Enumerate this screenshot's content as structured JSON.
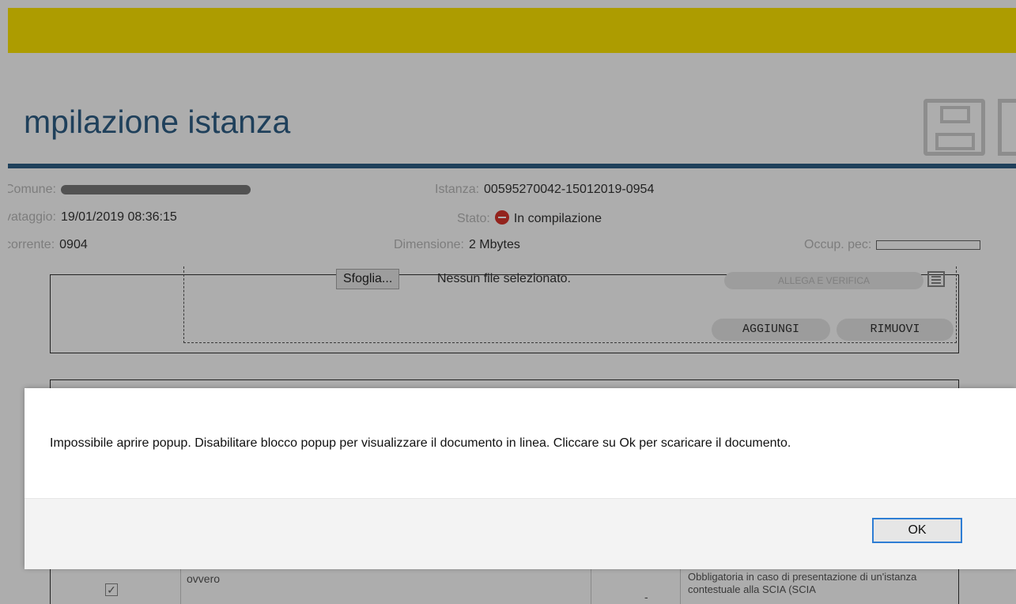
{
  "header": {
    "title": "mpilazione istanza"
  },
  "info": {
    "comune_label": "Comune:",
    "salvataggio_label": "vataggio:",
    "salvataggio_value": "19/01/2019 08:36:15",
    "corrente_label": "corrente:",
    "corrente_value": "0904",
    "istanza_label": "Istanza:",
    "istanza_value": "00595270042-15012019-0954",
    "stato_label": "Stato:",
    "stato_value": "In compilazione",
    "dimensione_label": "Dimensione:",
    "dimensione_value": "2 Mbytes",
    "occup_label": "Occup. pec:"
  },
  "upload": {
    "browse_label": "Sfoglia...",
    "no_file": "Nessun file selezionato.",
    "allega_label": "ALLEGA E VERIFICA",
    "add_label": "AGGIUNGI",
    "remove_label": "RIMUOVI"
  },
  "table": {
    "ovvero": "ovvero",
    "dash": "-",
    "note": "Obbligatoria in caso di presentazione di un'istanza contestuale alla SCIA (SCIA"
  },
  "dialog": {
    "message": "Impossibile aprire popup. Disabilitare blocco popup per visualizzare il documento in linea. Cliccare su Ok per scaricare il documento.",
    "ok_label": "OK"
  },
  "colors": {
    "top_bar": "#ffe600",
    "title": "#2f5f86",
    "stop": "#d9342b",
    "ok_border": "#2e7dd4"
  }
}
